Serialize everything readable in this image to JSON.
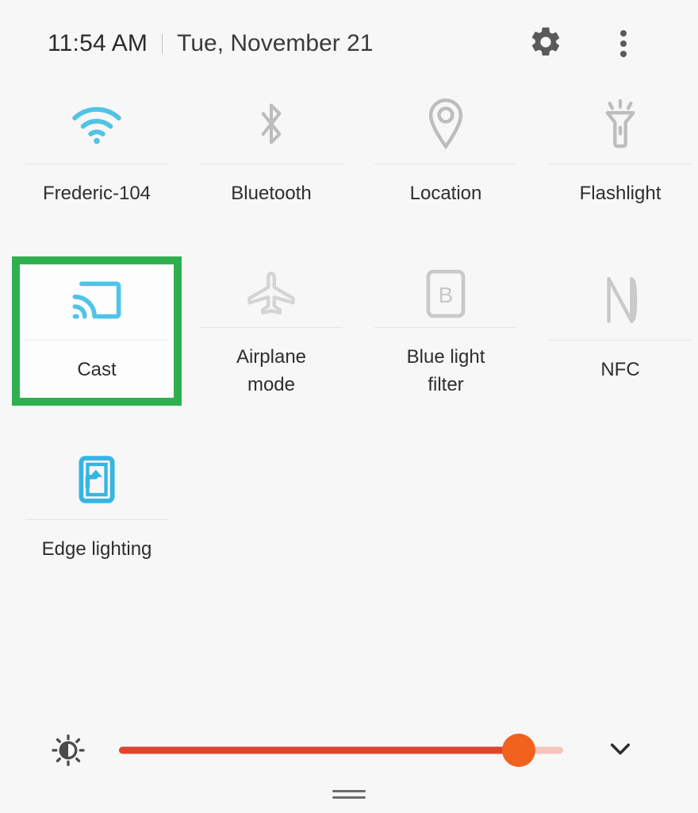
{
  "statusbar": {
    "time": "11:54 AM",
    "date": "Tue, November 21",
    "gear_icon": "gear-icon",
    "overflow_icon": "three-dots-menu-icon"
  },
  "colors": {
    "background": "#f7f7f7",
    "active_icon": "#4fc3e8",
    "inactive_icon": "#bdbdbd",
    "label_text": "#2e2e2e",
    "highlight_border": "#2eb050",
    "slider_fill": "#e0452c",
    "slider_thumb": "#f1621f",
    "slider_remainder": "#f5c4bc",
    "divider": "#e4e4e4"
  },
  "tiles": {
    "row1": [
      {
        "label": "Frederic-104",
        "icon": "wifi-icon",
        "state": "on"
      },
      {
        "label": "Bluetooth",
        "icon": "bluetooth-icon",
        "state": "off"
      },
      {
        "label": "Location",
        "icon": "location-pin-icon",
        "state": "off"
      },
      {
        "label": "Flashlight",
        "icon": "flashlight-icon",
        "state": "off"
      }
    ],
    "row2": [
      {
        "label": "Cast",
        "icon": "cast-icon",
        "state": "on",
        "highlighted": true
      },
      {
        "label": "Airplane\nmode",
        "icon": "airplane-icon",
        "state": "off"
      },
      {
        "label": "Blue light\nfilter",
        "icon": "blue-light-filter-icon",
        "state": "off"
      },
      {
        "label": "NFC",
        "icon": "nfc-icon",
        "state": "off"
      }
    ],
    "row3": [
      {
        "label": "Edge lighting",
        "icon": "edge-lighting-icon",
        "state": "on"
      }
    ]
  },
  "brightness": {
    "icon": "brightness-icon",
    "value_percent": 90,
    "expand_icon": "chevron-down-icon"
  },
  "handle": {
    "icon": "drag-handle-icon"
  }
}
